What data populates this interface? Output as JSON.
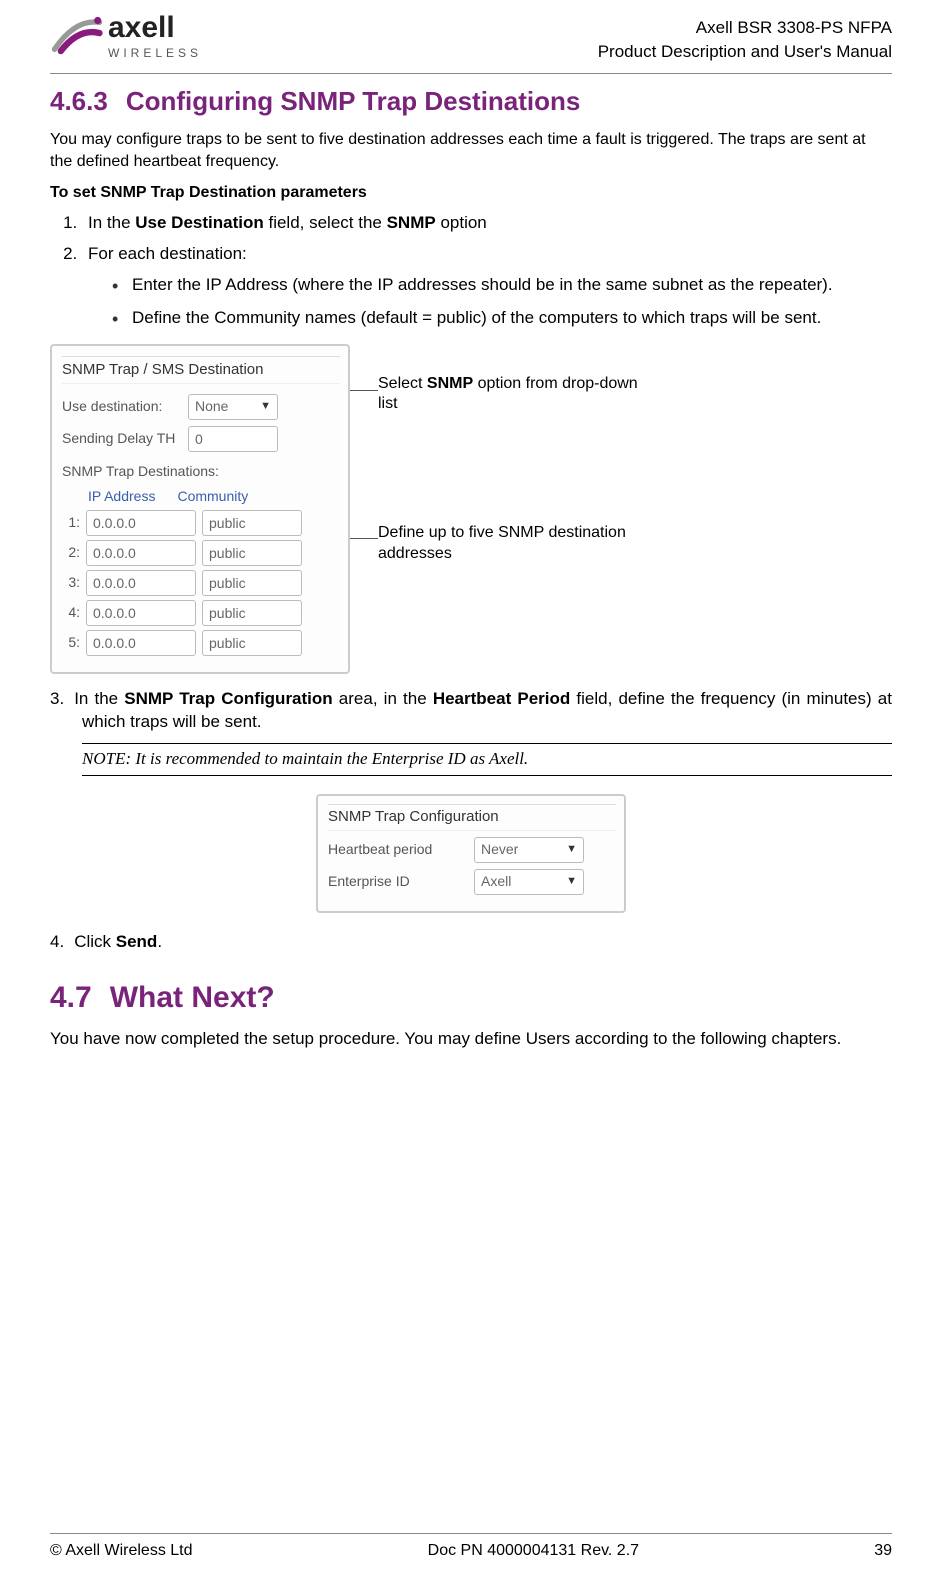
{
  "header": {
    "brand_main": "axell",
    "brand_sub": "WIRELESS",
    "doc_line1": "Axell BSR 3308-PS NFPA",
    "doc_line2": "Product Description and User's Manual"
  },
  "section": {
    "num": "4.6.3",
    "title": "Configuring SNMP Trap Destinations",
    "intro": "You may configure traps to be sent to five destination addresses each time a fault is triggered. The traps are sent at the defined heartbeat frequency.",
    "subhead": "To set SNMP Trap Destination parameters",
    "step1_pre": "In the ",
    "step1_bold1": "Use Destination",
    "step1_mid": " field, select the ",
    "step1_bold2": "SNMP",
    "step1_post": " option",
    "step2": "For each destination:",
    "bullet1": "Enter the IP Address (where the IP addresses should be in the same subnet as the repeater).",
    "bullet2": "Define the Community names (default = public) of the computers to which traps will be sent."
  },
  "panel1": {
    "title": "SNMP Trap / SMS Destination",
    "use_dest_label": "Use destination:",
    "use_dest_value": "None",
    "delay_label": "Sending Delay TH",
    "delay_value": "0",
    "dest_title": "SNMP Trap Destinations:",
    "col_ip": "IP Address",
    "col_comm": "Community",
    "rows": [
      {
        "n": "1:",
        "ip": "0.0.0.0",
        "comm": "public"
      },
      {
        "n": "2:",
        "ip": "0.0.0.0",
        "comm": "public"
      },
      {
        "n": "3:",
        "ip": "0.0.0.0",
        "comm": "public"
      },
      {
        "n": "4:",
        "ip": "0.0.0.0",
        "comm": "public"
      },
      {
        "n": "5:",
        "ip": "0.0.0.0",
        "comm": "public"
      }
    ]
  },
  "annot": {
    "a1_pre": "Select ",
    "a1_bold": "SNMP",
    "a1_post": " option from drop-down list",
    "a2": "Define up to five SNMP destination addresses"
  },
  "step3": {
    "num": "3.",
    "pre": "In the ",
    "b1": "SNMP Trap Configuration",
    "mid1": " area, in the ",
    "b2": "Heartbeat Period",
    "post": " field, define the frequency (in minutes) at which traps will be sent."
  },
  "note": "NOTE: It is recommended to maintain the Enterprise ID as Axell.",
  "panel2": {
    "title": "SNMP Trap Configuration",
    "hb_label": "Heartbeat period",
    "hb_value": "Never",
    "eid_label": "Enterprise ID",
    "eid_value": "Axell"
  },
  "step4": {
    "num": "4.",
    "pre": "Click ",
    "b": "Send",
    "post": "."
  },
  "section2": {
    "num": "4.7",
    "title": "What Next?",
    "body": "You have now completed the setup procedure. You may define Users according to the following chapters."
  },
  "footer": {
    "left": "© Axell Wireless Ltd",
    "center": "Doc PN 4000004131 Rev. 2.7",
    "right": "39"
  }
}
